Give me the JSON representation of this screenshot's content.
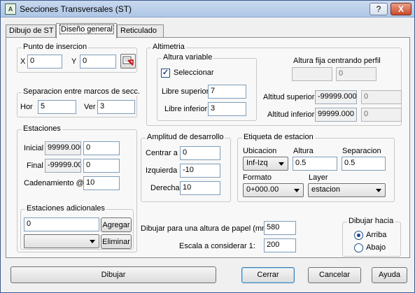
{
  "window": {
    "title": "Secciones Transversales (ST)",
    "icon_text": "A",
    "help_label": "?",
    "close_label": "X"
  },
  "tabs": [
    {
      "label": "Dibujo de ST"
    },
    {
      "label": "Diseño general"
    },
    {
      "label": "Reticulado"
    }
  ],
  "insercion": {
    "title": "Punto de insercion",
    "x_label": "X",
    "x_value": "0",
    "y_label": "Y",
    "y_value": "0"
  },
  "separacion": {
    "title": "Separacion entre marcos de secc.",
    "hor_label": "Hor",
    "hor_value": "5",
    "ver_label": "Ver",
    "ver_value": "3"
  },
  "altimetria": {
    "title": "Altimetria",
    "variable": {
      "title": "Altura variable",
      "checkbox_label": "Seleccionar",
      "checked": true,
      "sup_label": "Libre superior",
      "sup_value": "7",
      "inf_label": "Libre inferior",
      "inf_value": "3"
    },
    "fija": {
      "title": "Altura fija centrando perfil",
      "value1": "",
      "value2": "0"
    },
    "alt_sup_label": "Altitud superior",
    "alt_sup_value": "-99999.000",
    "alt_sup_value2": "0",
    "alt_inf_label": "Altitud inferior",
    "alt_inf_value": "99999.000",
    "alt_inf_value2": "0"
  },
  "estaciones": {
    "title": "Estaciones",
    "inicial_label": "Inicial",
    "inicial_value": "99999.000",
    "inicial_value2": "0",
    "final_label": "Final",
    "final_value": "-99999.00",
    "final_value2": "0",
    "caden_label": "Cadenamiento @",
    "caden_value": "10",
    "adicionales": {
      "title": "Estaciones adicionales",
      "value": "0",
      "agregar_label": "Agregar",
      "eliminar_label": "Eliminar"
    }
  },
  "amplitud": {
    "title": "Amplitud de desarrollo",
    "centrar_label": "Centrar a",
    "centrar_value": "0",
    "izq_label": "Izquierda",
    "izq_value": "-10",
    "der_label": "Derecha",
    "der_value": "10"
  },
  "etiqueta": {
    "title": "Etiqueta de estacion",
    "ubicacion_label": "Ubicacion",
    "ubicacion_value": "Inf-Izq",
    "altura_label": "Altura",
    "altura_value": "0.5",
    "separacion_label": "Separacion",
    "separacion_value": "0.5",
    "formato_label": "Formato",
    "formato_value": "0+000.00",
    "layer_label": "Layer",
    "layer_value": "estacion"
  },
  "papel": {
    "altura_label": "Dibujar para una altura de papel (mm)",
    "altura_value": "580",
    "escala_label": "Escala a considerar 1:",
    "escala_value": "200"
  },
  "dibujar_hacia": {
    "title": "Dibujar hacia",
    "arriba_label": "Arriba",
    "abajo_label": "Abajo",
    "selected": "Arriba"
  },
  "footer": {
    "dibujar_label": "Dibujar",
    "cerrar_label": "Cerrar",
    "cancelar_label": "Cancelar",
    "ayuda_label": "Ayuda"
  }
}
